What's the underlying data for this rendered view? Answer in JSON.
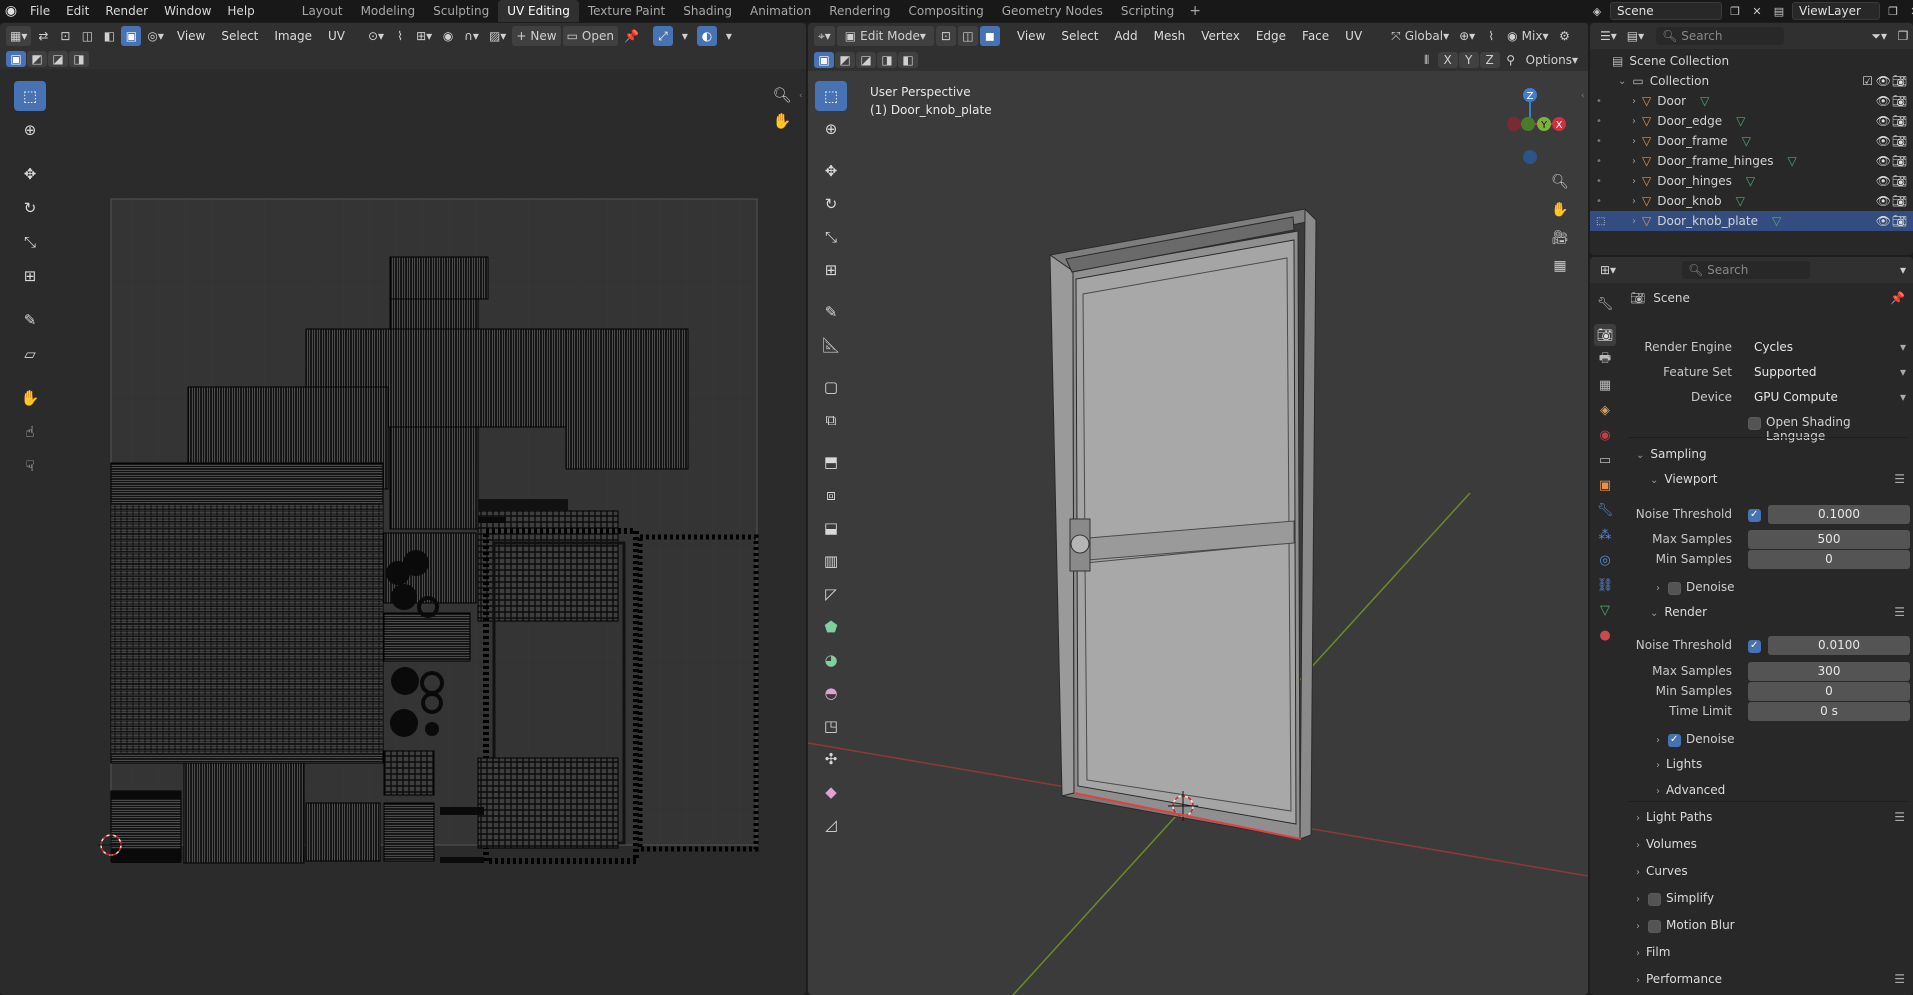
{
  "topbar": {
    "menus": [
      "File",
      "Edit",
      "Render",
      "Window",
      "Help"
    ],
    "workspaces": [
      "Layout",
      "Modeling",
      "Sculpting",
      "UV Editing",
      "Texture Paint",
      "Shading",
      "Animation",
      "Rendering",
      "Compositing",
      "Geometry Nodes",
      "Scripting"
    ],
    "active_workspace": "UV Editing",
    "scene": "Scene",
    "view_layer": "ViewLayer"
  },
  "uv_editor": {
    "menus": [
      "View",
      "Select",
      "Image",
      "UV"
    ],
    "new_label": "New",
    "open_label": "Open"
  },
  "viewport": {
    "mode": "Edit Mode",
    "menus": [
      "View",
      "Select",
      "Add",
      "Mesh",
      "Vertex",
      "Edge",
      "Face",
      "UV"
    ],
    "orientation": "Global",
    "shading": "Mix",
    "options_label": "Options",
    "axes": [
      "X",
      "Y",
      "Z"
    ],
    "overlay_line1": "User Perspective",
    "overlay_line2": "(1) Door_knob_plate",
    "gizmo_z": "Z",
    "gizmo_y": "Y",
    "gizmo_x": "X"
  },
  "outliner": {
    "search_placeholder": "Search",
    "root": "Scene Collection",
    "collection": "Collection",
    "items": [
      "Door",
      "Door_edge",
      "Door_frame",
      "Door_frame_hinges",
      "Door_hinges",
      "Door_knob",
      "Door_knob_plate"
    ],
    "selected": "Door_knob_plate"
  },
  "properties": {
    "search_placeholder": "Search",
    "context": "Scene",
    "render_engine_label": "Render Engine",
    "render_engine": "Cycles",
    "feature_set_label": "Feature Set",
    "feature_set": "Supported",
    "device_label": "Device",
    "device": "GPU Compute",
    "osl_label": "Open Shading Language",
    "sampling": "Sampling",
    "viewport": "Viewport",
    "noise_threshold_label": "Noise Threshold",
    "vp_noise_threshold": "0.1000",
    "max_samples_label": "Max Samples",
    "vp_max_samples": "500",
    "min_samples_label": "Min Samples",
    "vp_min_samples": "0",
    "denoise_label": "Denoise",
    "render": "Render",
    "r_noise_threshold": "0.0100",
    "r_max_samples": "300",
    "r_min_samples": "0",
    "time_limit_label": "Time Limit",
    "r_time_limit": "0 s",
    "lights": "Lights",
    "advanced": "Advanced",
    "light_paths": "Light Paths",
    "volumes": "Volumes",
    "curves": "Curves",
    "simplify": "Simplify",
    "motion_blur": "Motion Blur",
    "film": "Film",
    "performance": "Performance"
  }
}
